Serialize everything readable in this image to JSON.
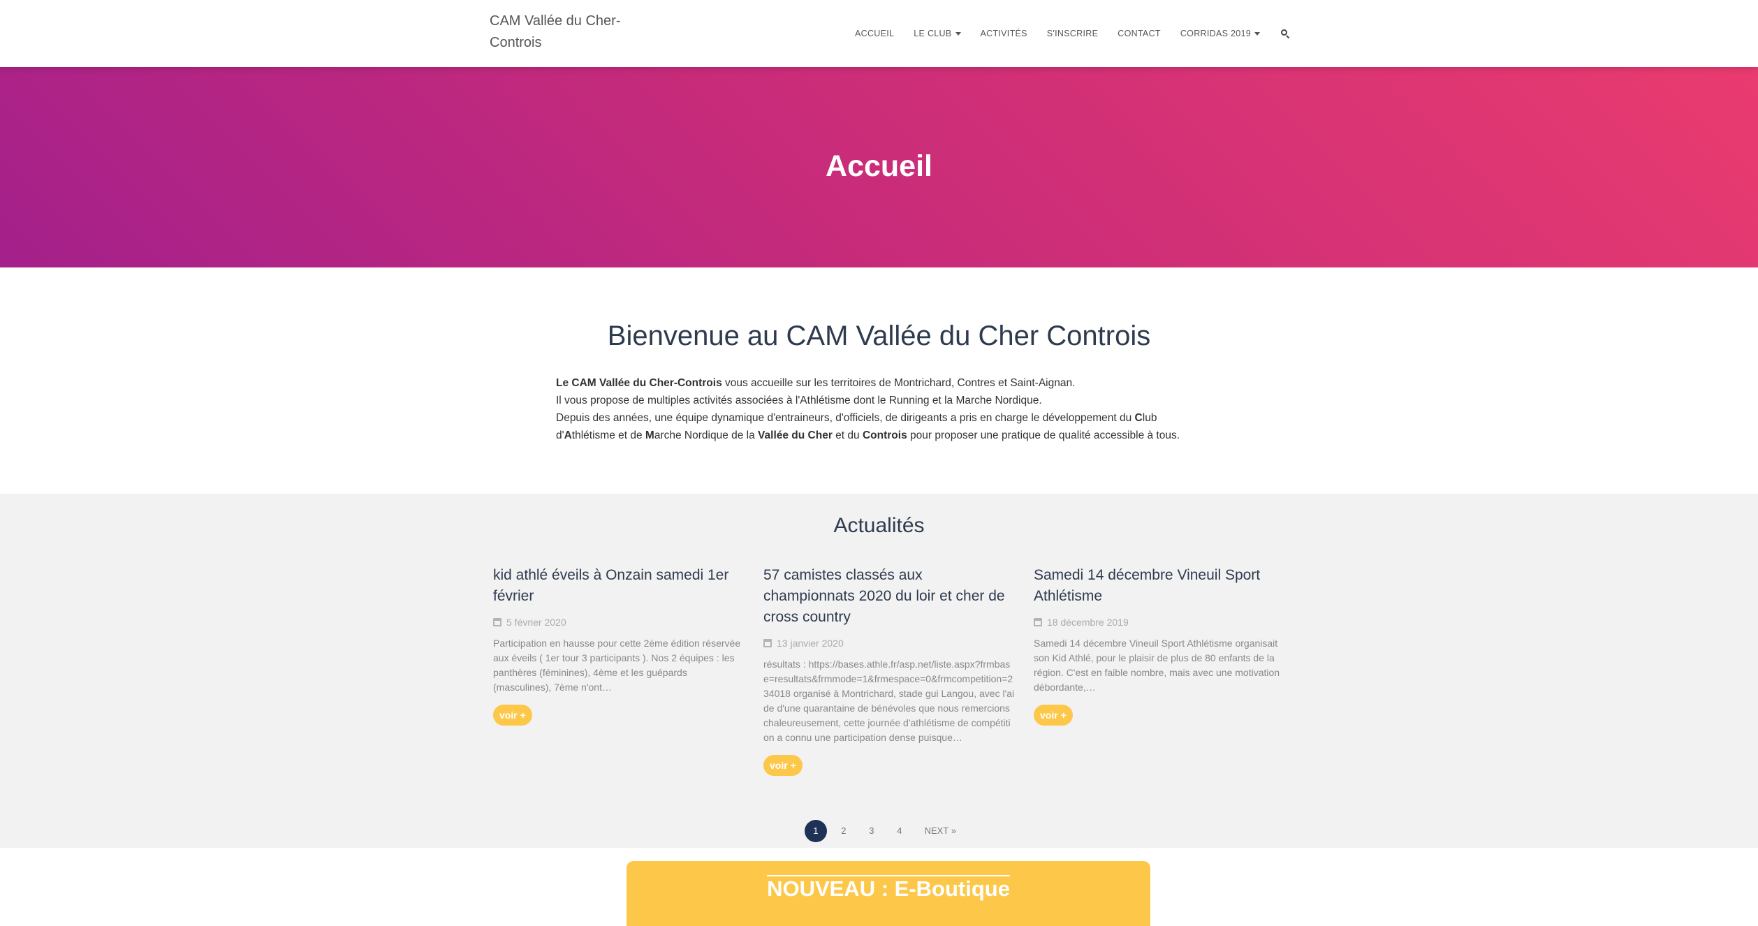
{
  "navbar": {
    "brand": "CAM Vallée du Cher-Controis",
    "items": [
      {
        "label": "ACCUEIL"
      },
      {
        "label": "LE CLUB"
      },
      {
        "label": "ACTIVITÉS"
      },
      {
        "label": "S'INSCRIRE"
      },
      {
        "label": "CONTACT"
      },
      {
        "label": "CORRIDAS 2019"
      }
    ],
    "search_icon": "search-icon"
  },
  "hero": {
    "title": "Accueil"
  },
  "welcome": {
    "title": "Bienvenue au CAM Vallée du Cher Controis",
    "line1_bold": "Le CAM Vallée du Cher-Controis",
    "line1_rest": " vous accueille sur les territoires de Montrichard, Contres et Saint-Aignan.",
    "line2": "Il vous propose de multiples activités associées à l'Athlétisme dont le Running et la Marche Nordique.",
    "line3_a": "Depuis des années, une équipe dynamique d'entraineurs, d'officiels, de dirigeants a pris en charge le développement du ",
    "line3_c": "C",
    "line3_club": "lub",
    "line4_d": "d'",
    "line4_a": "A",
    "line4_athl": "thlétisme et de ",
    "line4_m": "M",
    "line4_marche": "arche Nordique de la ",
    "line4_vallee": "Vallée du Cher",
    "line4_et": " et du ",
    "line4_controis": "Controis",
    "line4_rest": " pour proposer une pratique de qualité accessible à tous."
  },
  "news": {
    "title": "Actualités",
    "articles": [
      {
        "title": "kid athlé éveils à Onzain samedi 1er février",
        "date": "5 février 2020",
        "excerpt": "Participation en hausse pour cette 2ème édition réservée aux éveils ( 1er tour 3 participants ).  Nos 2 équipes : les panthères (féminines), 4ème et les guépards (masculines), 7ème n'ont…",
        "button": "voir +"
      },
      {
        "title": "57 camistes classés aux championnats 2020 du loir et cher de cross country",
        "date": "13 janvier 2020",
        "excerpt": "résultats :   https://bases.athle.fr/asp.net/liste.aspx?frmbase=resultats&frmmode=1&frmespace=0&frmcompetition=234018 organisé à Montrichard, stade gui Langou, avec l'aide d'une quarantaine de bénévoles que nous remercions chaleureusement, cette journée d'athlétisme de compétition a connu une participation dense puisque…",
        "button": "voir +"
      },
      {
        "title": "Samedi 14 décembre Vineuil Sport Athlétisme",
        "date": "18 décembre 2019",
        "excerpt": "Samedi 14 décembre Vineuil Sport Athlétisme organisait son Kid Athlé, pour le plaisir de plus de 80 enfants de la région. C'est en faible nombre, mais avec une  motivation débordante,…",
        "button": "voir +"
      }
    ],
    "pagination": {
      "pages": [
        "1",
        "2",
        "3",
        "4"
      ],
      "next": "NEXT »"
    }
  },
  "boutique": {
    "title": "NOUVEAU : E-Boutique"
  },
  "colors": {
    "hero_start": "#a4208b",
    "hero_end": "#e93b6f",
    "accent_yellow": "#fdc84a",
    "pagination_active": "#1e3255",
    "news_bg": "#f2f2f2"
  }
}
